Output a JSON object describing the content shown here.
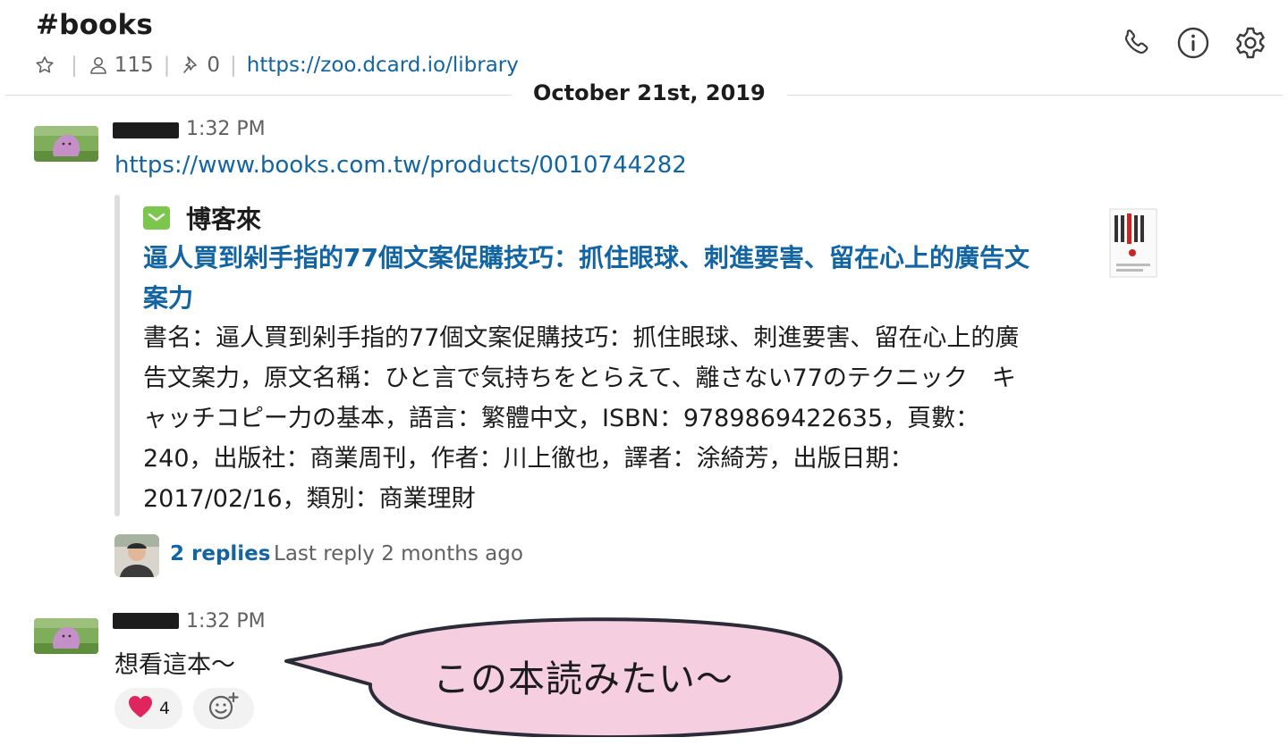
{
  "header": {
    "channel_name": "#books",
    "member_count": "115",
    "pinned_count": "0",
    "channel_link": "https://zoo.dcard.io/library",
    "icons": [
      "star-icon",
      "members-icon",
      "pin-icon",
      "phone-icon",
      "info-icon",
      "gear-icon"
    ]
  },
  "date_divider": "October 21st, 2019",
  "messages": [
    {
      "timestamp": "1:32 PM",
      "link": "https://www.books.com.tw/products/0010744282",
      "attachment": {
        "service_name": "博客來",
        "title": "逼人買到剁手指的77個文案促購技巧：抓住眼球、刺進要害、留在心上的廣告文案力",
        "description": "書名：逼人買到剁手指的77個文案促購技巧：抓住眼球、刺進要害、留在心上的廣告文案力，原文名稱：ひと言で気持ちをとらえて、離さない77のテクニック　キャッチコピー力の基本，語言：繁體中文，ISBN：9789869422635，頁數：240，出版社：商業周刊，作者：川上徹也，譯者：涂綺芳，出版日期：2017/02/16，類別：商業理財"
      },
      "thread": {
        "replies_label": "2 replies",
        "last_reply_label": "Last reply 2 months ago"
      }
    },
    {
      "timestamp": "1:32 PM",
      "text": "想看這本～",
      "reactions": [
        {
          "emoji": "heart-icon",
          "count": "4"
        }
      ],
      "add_reaction_icon": "add-emoji-icon"
    }
  ],
  "speech_bubble": {
    "text": "この本読みたい〜"
  },
  "colors": {
    "link": "#1264a3",
    "muted_text": "#616061",
    "bubble_fill": "#f5cfdf",
    "heart": "#e0245e"
  }
}
